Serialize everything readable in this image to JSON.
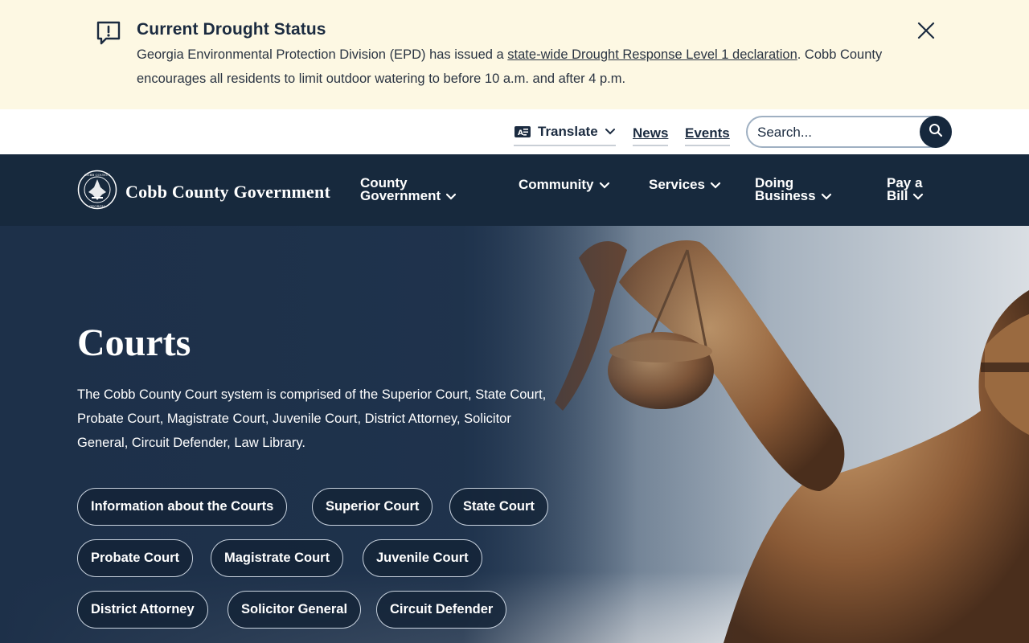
{
  "alert": {
    "title": "Current Drought Status",
    "text_before": "Georgia Environmental Protection Division (EPD) has issued a ",
    "link": "state-wide Drought Response Level 1 declaration",
    "text_after": ". Cobb County encourages all residents to limit outdoor watering to before 10 a.m. and after 4 p.m."
  },
  "utility": {
    "translate": "Translate",
    "news": "News",
    "events": "Events",
    "search_placeholder": "Search..."
  },
  "brand": {
    "name": "Cobb County Government"
  },
  "nav": {
    "county_government_1": "County",
    "county_government_2": "Government",
    "community": "Community",
    "services": "Services",
    "doing_business_1": "Doing",
    "doing_business_2": "Business",
    "pay_bill_1": "Pay a",
    "pay_bill_2": "Bill"
  },
  "hero": {
    "title": "Courts",
    "description": "The Cobb County Court system is comprised of the Superior Court, State Court, Probate Court, Magistrate Court, Juvenile Court, District Attorney, Solicitor General, Circuit Defender, Law Library.",
    "buttons": [
      "Information about the Courts",
      "Superior Court",
      "State Court",
      "Probate Court",
      "Magistrate Court",
      "Juvenile Court",
      "District Attorney",
      "Solicitor General",
      "Circuit Defender"
    ]
  },
  "colors": {
    "alert_bg": "#fdf8e3",
    "nav_bg": "#17293d",
    "hero_overlay": "#22364f"
  }
}
